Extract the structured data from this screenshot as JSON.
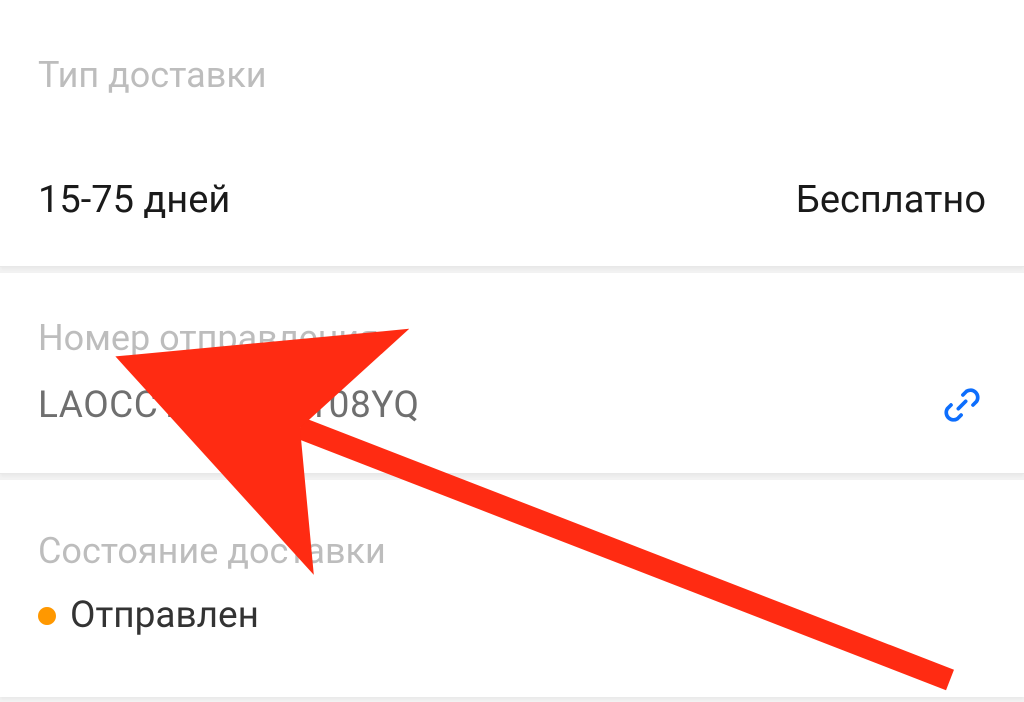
{
  "delivery": {
    "label": "Тип доставки",
    "duration": "15-75 дней",
    "cost": "Бесплатно"
  },
  "tracking": {
    "label": "Номер отправления",
    "number": "LAOCC1007722108YQ"
  },
  "status": {
    "label": "Состояние доставки",
    "text": "Отправлен",
    "dot_color": "#ff9800"
  },
  "colors": {
    "link": "#0d6efd",
    "arrow": "#ff2b12",
    "label": "#bdbdbd",
    "text": "#333333"
  }
}
